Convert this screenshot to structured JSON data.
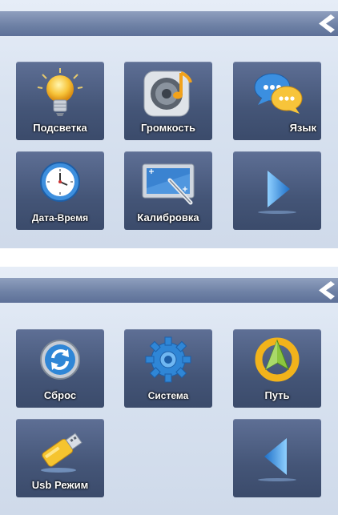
{
  "panel_top": {
    "tiles": [
      {
        "label": "Подсветка",
        "icon": "lightbulb-icon"
      },
      {
        "label": "Громкость",
        "icon": "speaker-icon"
      },
      {
        "label": "Язык",
        "icon": "chat-bubbles-icon"
      },
      {
        "label": "Дата-Время",
        "icon": "clock-icon"
      },
      {
        "label": "Калибровка",
        "icon": "stylus-calibration-icon"
      },
      {
        "label": "",
        "icon": "arrow-right-icon"
      }
    ]
  },
  "panel_bottom": {
    "tiles": [
      {
        "label": "Сброс",
        "icon": "reset-icon"
      },
      {
        "label": "Система",
        "icon": "gear-icon"
      },
      {
        "label": "Путь",
        "icon": "navigation-arrow-icon"
      },
      {
        "label": "Usb Режим",
        "icon": "usb-drive-icon"
      },
      {
        "label": "",
        "icon": "arrow-left-icon"
      }
    ]
  },
  "colors": {
    "header": "#6f82a6",
    "tile": "#445577",
    "background": "#d8e2f0",
    "accent_blue": "#2f86d6",
    "accent_orange": "#f2a21b"
  }
}
